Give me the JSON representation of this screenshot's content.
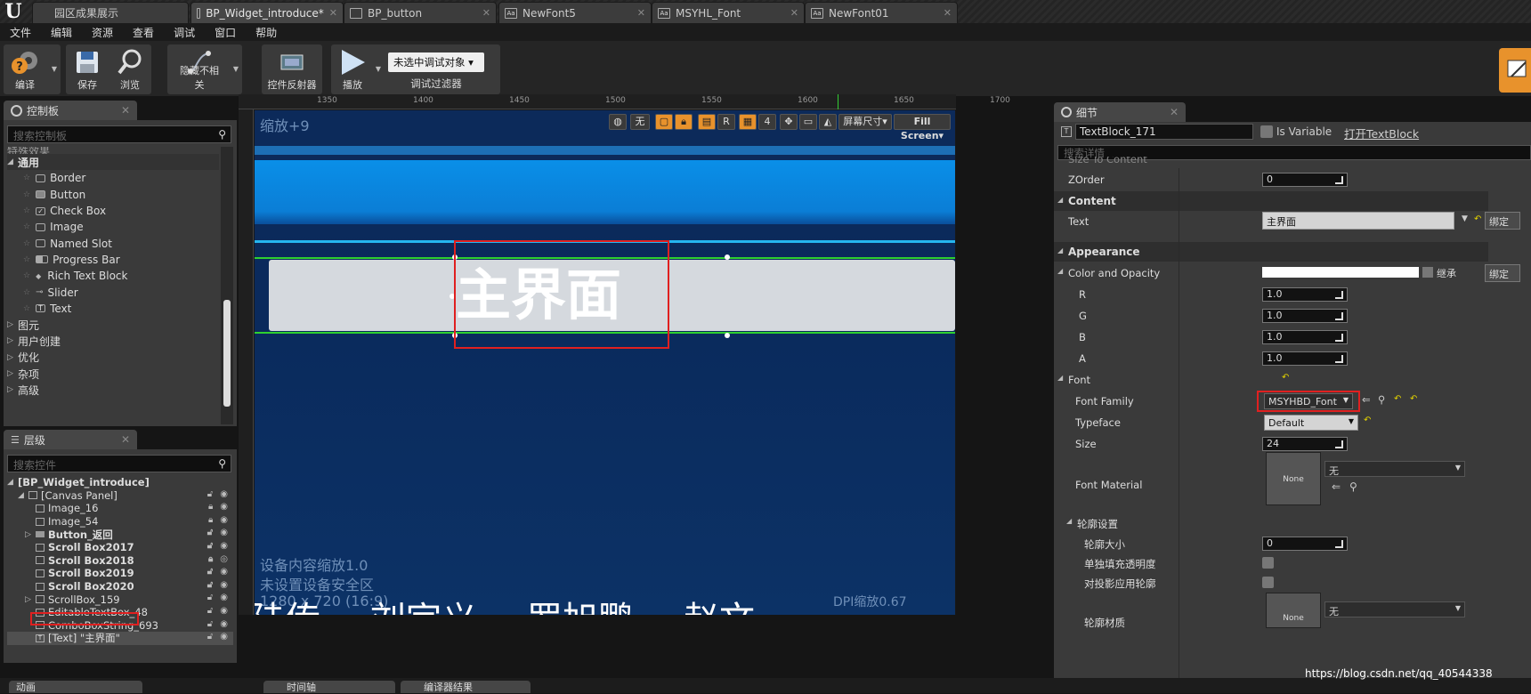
{
  "tabs": {
    "t0": "园区成果展示",
    "t1": "BP_Widget_introduce*",
    "t2": "BP_button",
    "t3": "NewFont5",
    "t4": "MSYHL_Font",
    "t5": "NewFont01"
  },
  "menu": [
    "文件",
    "编辑",
    "资源",
    "查看",
    "调试",
    "窗口",
    "帮助"
  ],
  "toolbar": {
    "compile": "编译",
    "save": "保存",
    "browse": "浏览",
    "hide_unrelated": "隐藏不相关",
    "widget_reflector": "控件反射器",
    "play": "播放",
    "debug_target": "未选中调试对象",
    "debug_filter": "调试过滤器"
  },
  "palette": {
    "title": "控制板",
    "search_placeholder": "搜索控制板",
    "partial_top": "特殊效果",
    "common": "通用",
    "items": [
      "Border",
      "Button",
      "Check Box",
      "Image",
      "Named Slot",
      "Progress Bar",
      "Rich Text Block",
      "Slider",
      "Text"
    ],
    "categories": [
      "图元",
      "用户创建",
      "优化",
      "杂项",
      "高级"
    ]
  },
  "hierarchy": {
    "title": "层级",
    "search_placeholder": "搜索控件",
    "root": "[BP_Widget_introduce]",
    "canvas": "[Canvas Panel]",
    "items": [
      "Image_16",
      "Image_54",
      "Button_返回",
      "Scroll Box2017",
      "Scroll Box2018",
      "Scroll Box2019",
      "Scroll Box2020",
      "ScrollBox_159",
      "EditableTextBox_48",
      "ComboBoxString_693",
      "[Text] \"主界面\""
    ]
  },
  "bottom_tabs": {
    "anim": "动画",
    "timeline": "时间轴",
    "compile_result": "编译器结果"
  },
  "ruler": {
    "x": [
      "1350",
      "1400",
      "1450",
      "1500",
      "1550",
      "1600",
      "1650",
      "1700"
    ]
  },
  "viewport": {
    "zoom": "缩放+9",
    "none": "无",
    "R": "R",
    "four": "4",
    "screen_size": "屏幕尺寸",
    "fill_screen": "Fill Screen",
    "device_scale": "设备内容缩放1.0",
    "safe_zone": "未设置设备安全区",
    "resolution": "1280 x 720 (16:9)",
    "banner_text": "主界面",
    "bottom_names": [
      "陆传",
      "刘宇义",
      "罗旭鹏",
      "赵文"
    ],
    "dpi": "DPI缩放0.67"
  },
  "details": {
    "title": "细节",
    "name": "TextBlock_171",
    "is_variable": "Is Variable",
    "open": "打开TextBlock",
    "search_placeholder": "搜索详情",
    "partial": "Size To Content",
    "zorder_label": "ZOrder",
    "zorder": "0",
    "content": "Content",
    "text_label": "Text",
    "text_value": "主界面",
    "bind": "绑定",
    "appearance": "Appearance",
    "color_opacity": "Color and Opacity",
    "inherit": "继承",
    "r_label": "R",
    "r": "1.0",
    "g_label": "G",
    "g": "1.0",
    "b_label": "B",
    "b": "1.0",
    "a_label": "A",
    "a": "1.0",
    "font": "Font",
    "font_family_label": "Font Family",
    "font_family": "MSYHBD_Font",
    "typeface_label": "Typeface",
    "typeface": "Default",
    "size_label": "Size",
    "size": "24",
    "font_material_label": "Font Material",
    "none": "None",
    "none_cn": "无",
    "outline": "轮廓设置",
    "outline_size_label": "轮廓大小",
    "outline_size": "0",
    "sep_alpha": "单独填充透明度",
    "apply_shadow": "对投影应用轮廓",
    "outline_material": "轮廓材质"
  },
  "watermark": "https://blog.csdn.net/qq_40544338",
  "colors": {
    "accent": "#e8922c",
    "highlight": "#e02020",
    "bg": "#151515"
  }
}
